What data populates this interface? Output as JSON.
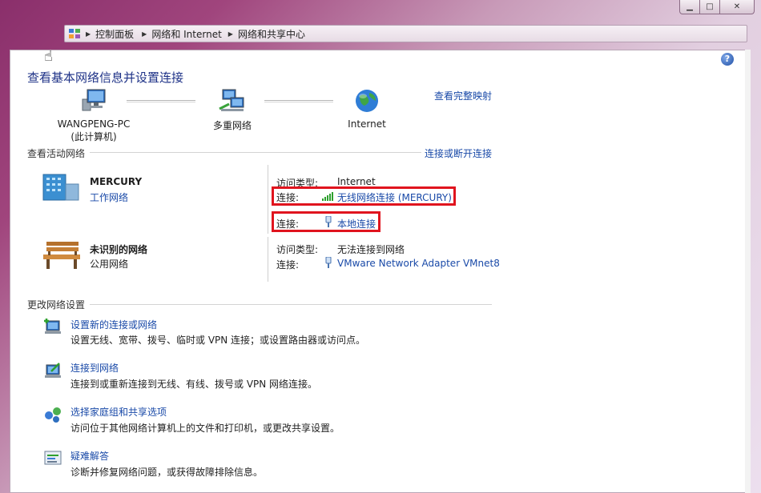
{
  "window": {
    "caption_buttons": [
      "minimize",
      "maximize",
      "close"
    ]
  },
  "breadcrumb": {
    "items": [
      "控制面板",
      "网络和 Internet",
      "网络和共享中心"
    ]
  },
  "page_title": "查看基本网络信息并设置连接",
  "map": {
    "full_map_link": "查看完整映射",
    "nodes": [
      {
        "line1": "WANGPENG-PC",
        "line2": "(此计算机)"
      },
      {
        "line1": "多重网络"
      },
      {
        "line1": "Internet"
      }
    ]
  },
  "active_networks": {
    "heading": "查看活动网络",
    "connect_link": "连接或断开连接",
    "networks": [
      {
        "name": "MERCURY",
        "type": "工作网络",
        "access_label": "访问类型:",
        "access_value": "Internet",
        "connections": [
          {
            "label": "连接:",
            "value": "无线网络连接 (MERCURY)",
            "icon": "wifi-signal-icon"
          },
          {
            "label": "连接:",
            "value": "本地连接",
            "icon": "ethernet-plug-icon"
          }
        ]
      },
      {
        "name": "未识别的网络",
        "type": "公用网络",
        "access_label": "访问类型:",
        "access_value": "无法连接到网络",
        "connections": [
          {
            "label": "连接:",
            "value": "VMware Network Adapter VMnet8",
            "icon": "ethernet-plug-icon"
          }
        ]
      }
    ]
  },
  "change_settings": {
    "heading": "更改网络设置",
    "tasks": [
      {
        "link": "设置新的连接或网络",
        "desc": "设置无线、宽带、拨号、临时或 VPN 连接；或设置路由器或访问点。"
      },
      {
        "link": "连接到网络",
        "desc": "连接到或重新连接到无线、有线、拨号或 VPN 网络连接。"
      },
      {
        "link": "选择家庭组和共享选项",
        "desc": "访问位于其他网络计算机上的文件和打印机，或更改共享设置。"
      },
      {
        "link": "疑难解答",
        "desc": "诊断并修复网络问题，或获得故障排除信息。"
      }
    ]
  },
  "colors": {
    "link": "#1a4aa8",
    "title": "#1e3287",
    "highlight_box": "#e0141e"
  }
}
